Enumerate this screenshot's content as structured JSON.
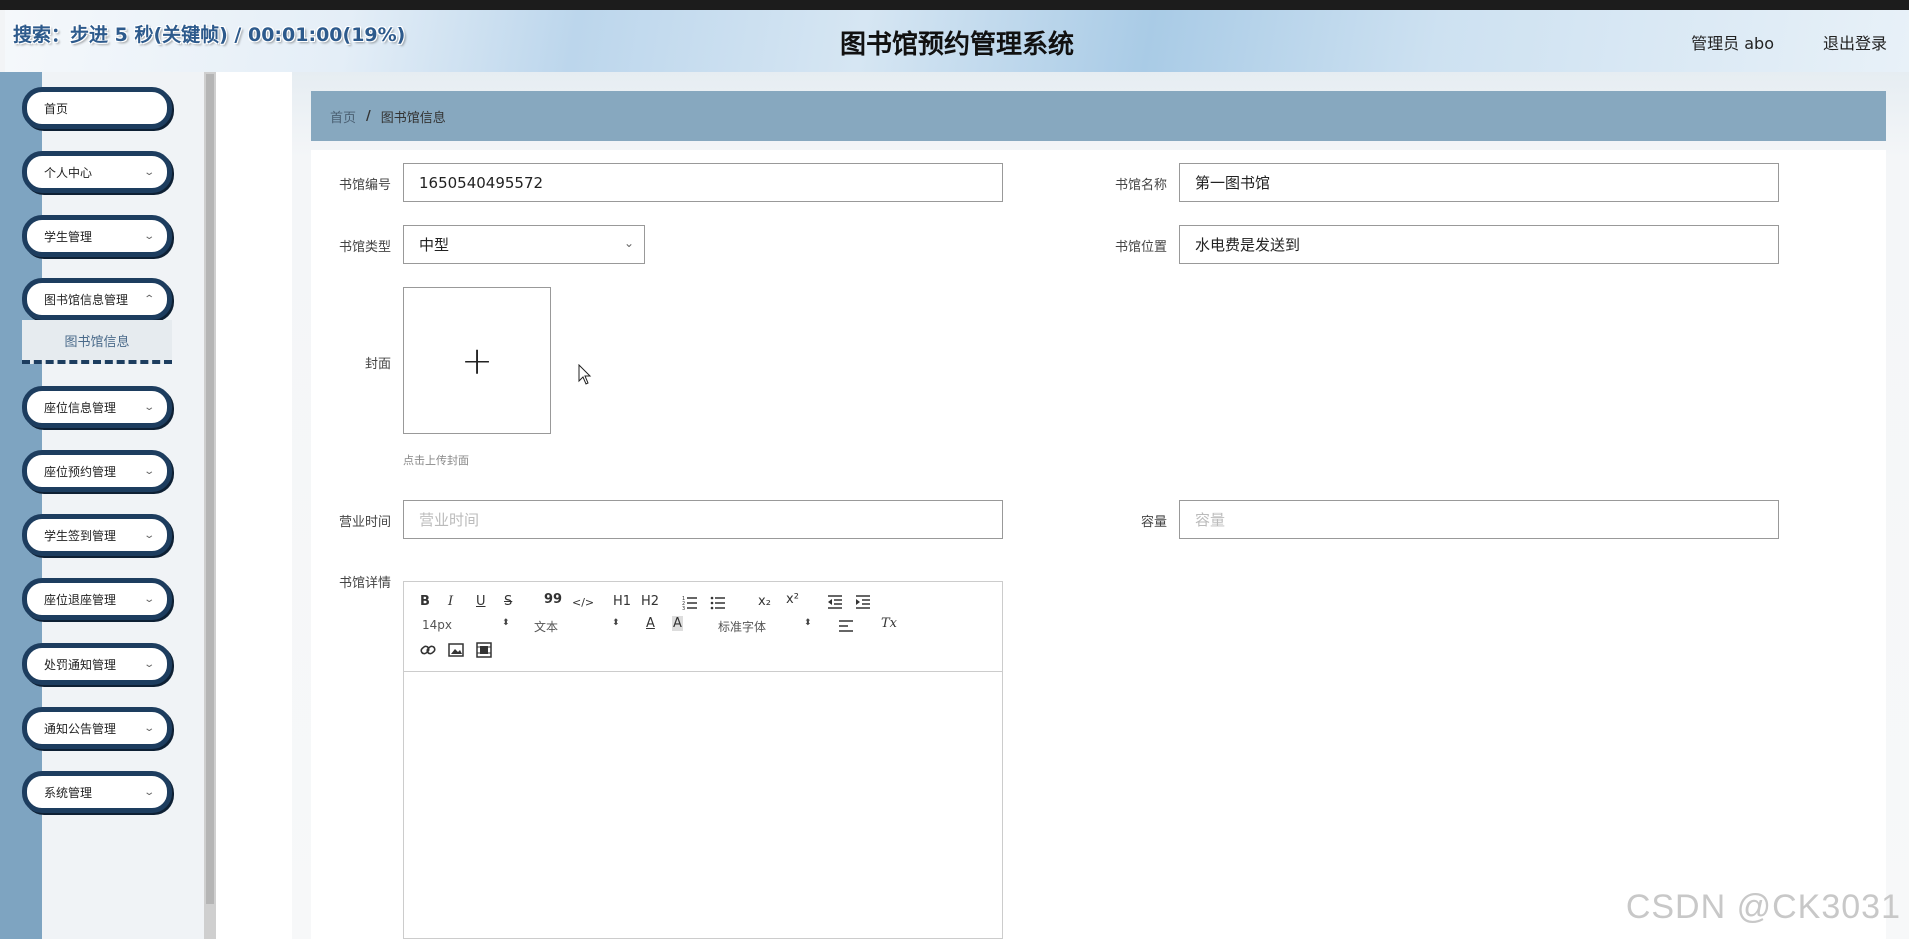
{
  "overlay": {
    "search_status": "搜索：步进 5 秒(关键帧) / 00:01:00(19%)"
  },
  "header": {
    "title": "图书馆预约管理系统",
    "admin_label": "管理员 abo",
    "logout_label": "退出登录"
  },
  "sidebar": {
    "items": [
      {
        "label": "首页",
        "has_children": false
      },
      {
        "label": "个人中心",
        "has_children": true
      },
      {
        "label": "学生管理",
        "has_children": true
      },
      {
        "label": "图书馆信息管理",
        "has_children": true,
        "expanded": true
      },
      {
        "label": "座位信息管理",
        "has_children": true
      },
      {
        "label": "座位预约管理",
        "has_children": true
      },
      {
        "label": "学生签到管理",
        "has_children": true
      },
      {
        "label": "座位退座管理",
        "has_children": true
      },
      {
        "label": "处罚通知管理",
        "has_children": true
      },
      {
        "label": "通知公告管理",
        "has_children": true
      },
      {
        "label": "系统管理",
        "has_children": true
      }
    ],
    "active_subitem": "图书馆信息"
  },
  "breadcrumb": {
    "home": "首页",
    "separator": "/",
    "current": "图书馆信息"
  },
  "form": {
    "library_no": {
      "label": "书馆编号",
      "value": "1650540495572"
    },
    "library_name": {
      "label": "书馆名称",
      "value": "第一图书馆"
    },
    "library_type": {
      "label": "书馆类型",
      "value": "中型"
    },
    "library_location": {
      "label": "书馆位置",
      "value": "水电费是发送到"
    },
    "cover": {
      "label": "封面",
      "hint": "点击上传封面"
    },
    "business_hours": {
      "label": "营业时间",
      "placeholder": "营业时间"
    },
    "capacity": {
      "label": "容量",
      "placeholder": "容量"
    },
    "details": {
      "label": "书馆详情",
      "toolbar": {
        "bold": "B",
        "italic": "I",
        "underline": "U",
        "strike": "S",
        "quote": "99",
        "code": "</>",
        "h1": "H1",
        "h2": "H2",
        "sub": "x₂",
        "sup": "x²",
        "size": "14px",
        "block": "文本",
        "font": "标准字体",
        "clear": "Tx"
      }
    }
  },
  "watermark": "CSDN @CK3031",
  "colors": {
    "menu_border": "#1d3d5f",
    "breadcrumb_bg": "#87a8bf",
    "sidebar_strip": "#7ea4c1"
  }
}
